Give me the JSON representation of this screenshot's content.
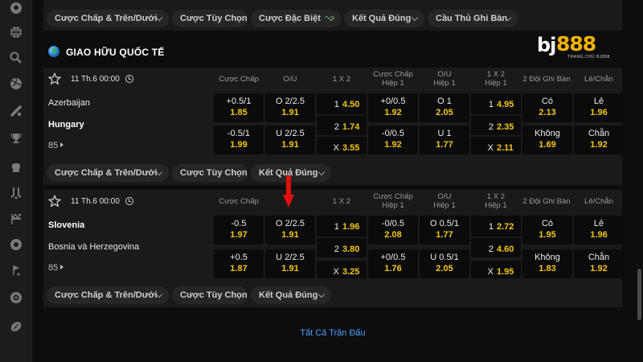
{
  "top_chips": [
    {
      "label": "Cược Chấp & Trên/Dưới",
      "hot": false
    },
    {
      "label": "Cược Tùy Chọn",
      "hot": false
    },
    {
      "label": "Cược Đặc Biệt",
      "hot": true
    },
    {
      "label": "Kết Quả Đúng",
      "hot": false
    },
    {
      "label": "Cầu Thủ Ghi Bàn",
      "hot": false
    }
  ],
  "league": {
    "title": "GIAO HỮU QUỐC TẾ"
  },
  "logo": {
    "prefix": "bj",
    "number": "888",
    "tagline": "TRANG CHỦ BJ888"
  },
  "matches": [
    {
      "time": "11 Th.6 00:00",
      "team1": "Azerbaijan",
      "team2": "Hungary",
      "more": "85",
      "headers": [
        "Cược Chấp",
        "O/U",
        "1 X 2",
        "Cược Chấp\nHiệp 1",
        "O/U\nHiệp 1",
        "1 X 2\nHiệp 1",
        "2 Đội Ghi Bàn",
        "Lẻ/Chẵn"
      ],
      "row1": [
        {
          "l": "+0.5/1",
          "o": "1.85"
        },
        {
          "l": "O 2/2.5",
          "o": "1.91"
        },
        {
          "l": "1",
          "o": "4.50"
        },
        {
          "l": "+0/0.5",
          "o": "1.92"
        },
        {
          "l": "O 1",
          "o": "2.05"
        },
        {
          "l": "1",
          "o": "4.95"
        },
        {
          "l": "Có",
          "o": "2.13"
        },
        {
          "l": "Lẻ",
          "o": "1.96"
        }
      ],
      "row2": [
        {
          "l": "-0.5/1",
          "o": "1.99"
        },
        {
          "l": "U 2/2.5",
          "o": "1.91"
        },
        {
          "l": "2",
          "o": "1.74"
        },
        {
          "l": "-0/0.5",
          "o": "1.92"
        },
        {
          "l": "U 1",
          "o": "1.77"
        },
        {
          "l": "2",
          "o": "2.35"
        },
        {
          "l": "Không",
          "o": "1.69"
        },
        {
          "l": "Chẵn",
          "o": "1.92"
        }
      ],
      "row3": [
        {
          "l": "X",
          "o": "3.55"
        },
        {
          "l": "X",
          "o": "2.11"
        }
      ],
      "chips": [
        "Cược Chấp & Trên/Dưới",
        "Cược Tùy Chọn",
        "Kết Quả Đúng"
      ]
    },
    {
      "time": "11 Th.6 00:00",
      "team1": "Slovenia",
      "team2": "Bosnia và Herzegovina",
      "more": "85",
      "headers": [
        "Cược Chấp",
        "O/U",
        "1 X 2",
        "Cược Chấp\nHiệp 1",
        "O/U\nHiệp 1",
        "1 X 2\nHiệp 1",
        "2 Đội Ghi Bàn",
        "Lẻ/Chẵn"
      ],
      "row1": [
        {
          "l": "-0.5",
          "o": "1.97"
        },
        {
          "l": "O 2/2.5",
          "o": "1.91"
        },
        {
          "l": "1",
          "o": "1.96"
        },
        {
          "l": "-0/0.5",
          "o": "2.08"
        },
        {
          "l": "O 0.5/1",
          "o": "1.77"
        },
        {
          "l": "1",
          "o": "2.72"
        },
        {
          "l": "Có",
          "o": "1.95"
        },
        {
          "l": "Lẻ",
          "o": "1.96"
        }
      ],
      "row2": [
        {
          "l": "+0.5",
          "o": "1.87"
        },
        {
          "l": "U 2/2.5",
          "o": "1.91"
        },
        {
          "l": "2",
          "o": "3.80"
        },
        {
          "l": "+0/0.5",
          "o": "1.76"
        },
        {
          "l": "U 0.5/1",
          "o": "2.05"
        },
        {
          "l": "2",
          "o": "4.60"
        },
        {
          "l": "Không",
          "o": "1.83"
        },
        {
          "l": "Chẵn",
          "o": "1.92"
        }
      ],
      "row3": [
        {
          "l": "X",
          "o": "3.25"
        },
        {
          "l": "X",
          "o": "1.95"
        }
      ],
      "chips": [
        "Cược Chấp & Trên/Dưới",
        "Cược Tùy Chọn",
        "Kết Quả Đúng"
      ]
    }
  ],
  "all_matches_link": "Tất Cả Trận Đấu",
  "colors": {
    "odds": "#f5c518",
    "link": "#4aa3ff",
    "arrow": "#e01010"
  },
  "sidebar_icons": [
    "soccer-ball-icon",
    "basketball-icon",
    "tennis-icon",
    "volleyball-icon",
    "baseball-icon",
    "trophy-icon",
    "boxing-icon",
    "hockey-icon",
    "racing-flag-icon",
    "esports-icon",
    "golf-icon",
    "snooker-icon",
    "rugby-icon"
  ]
}
